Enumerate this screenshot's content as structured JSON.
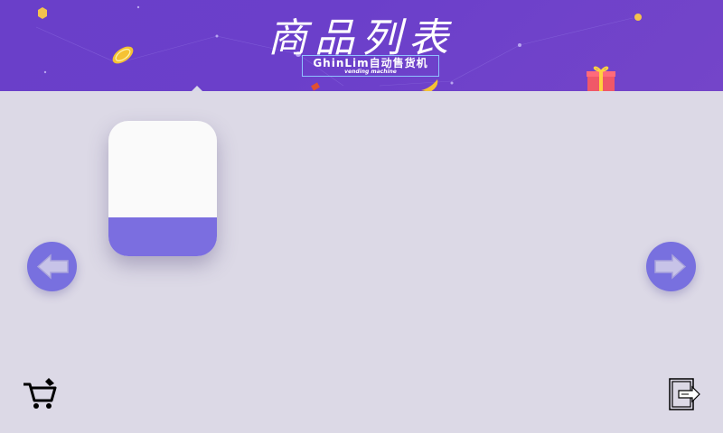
{
  "header": {
    "title": "商品列表",
    "subtitle": "GhinLim自动售货机",
    "subtitle_small": "vending machine",
    "bg_color": "#6b3fca"
  },
  "products": [
    {
      "name": "",
      "card_top_color": "#fafafa",
      "card_bottom_color": "#7b6ee0"
    }
  ],
  "nav": {
    "prev_icon": "arrow-left-icon",
    "next_icon": "arrow-right-icon",
    "button_color": "#7870df"
  },
  "footer": {
    "cart_icon": "shopping-cart-icon",
    "exit_icon": "exit-icon"
  },
  "colors": {
    "background": "#dcd9e6",
    "accent": "#7870df"
  }
}
